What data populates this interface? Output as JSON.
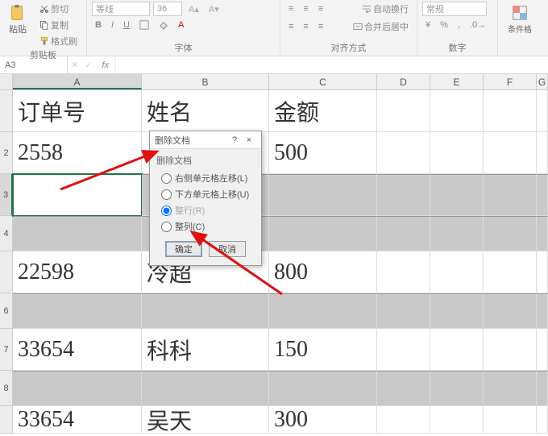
{
  "ribbon": {
    "paste": "粘贴",
    "cut": "剪切",
    "copy": "复制",
    "format_painter": "格式刷",
    "clipboard_group": "剪贴板",
    "font_name": "等线",
    "font_size": "36",
    "bold": "B",
    "italic": "I",
    "underline": "U",
    "font_group": "字体",
    "wrap": "自动换行",
    "merge": "合并后居中",
    "align_group": "对齐方式",
    "num_format": "常规",
    "percent": "%",
    "comma": ",",
    "num_group": "数字",
    "cond_fmt": "条件格"
  },
  "formula_bar": {
    "name_box": "A3",
    "fx": "fx"
  },
  "columns": {
    "A": "A",
    "B": "B",
    "C": "C",
    "D": "D",
    "E": "E",
    "F": "F",
    "G": "G"
  },
  "col_widths": {
    "A": 160,
    "B": 158,
    "C": 134,
    "D": 66,
    "E": 66,
    "F": 66,
    "G": 14
  },
  "row_labels": {
    "r1": "",
    "r2": "2",
    "r3": "3",
    "r4": "4",
    "r5": "",
    "r6": "6",
    "r7": "7",
    "r8": "8",
    "r9": ""
  },
  "row_heights": {
    "r1": 52,
    "r2": 52,
    "r3": 52,
    "r4": 44,
    "r5": 52,
    "r6": 44,
    "r7": 52,
    "r8": 44,
    "r9": 34
  },
  "grid": {
    "header": {
      "A": "订单号",
      "B": "姓名",
      "C": "金额"
    },
    "r2": {
      "A": "2558",
      "B": "",
      "C": "500"
    },
    "r5": {
      "A": "22598",
      "B": "冷超",
      "C": "800"
    },
    "r7": {
      "A": "33654",
      "B": "科科",
      "C": "150"
    },
    "r9": {
      "A": "33654",
      "B": "吴天",
      "C": "300"
    }
  },
  "dialog": {
    "title": "删除文档",
    "help": "?",
    "close": "×",
    "group": "删除文档",
    "opt_left": "右侧单元格左移(L)",
    "opt_up": "下方单元格上移(U)",
    "opt_row": "整行(R)",
    "opt_col": "整列(C)",
    "ok": "确定",
    "cancel": "取消"
  }
}
